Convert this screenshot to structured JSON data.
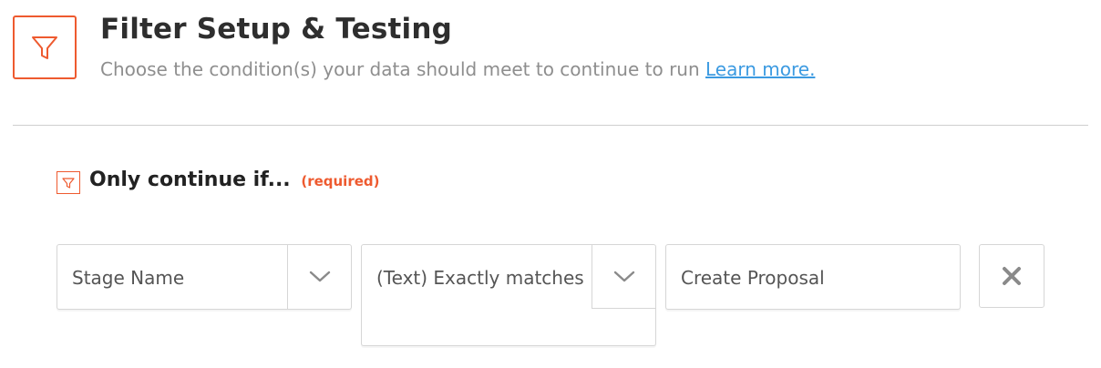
{
  "header": {
    "title": "Filter Setup & Testing",
    "subtitle": "Choose the condition(s) your data should meet to continue to run",
    "learn_more_label": "Learn more.",
    "icon": "filter-icon",
    "accent_color": "#ee5a2f",
    "link_color": "#3b9ae1"
  },
  "section": {
    "heading": "Only continue if...",
    "required_label": "(required)",
    "icon": "filter-icon"
  },
  "condition": {
    "field": {
      "value": "Stage Name",
      "icon": "chevron-down-icon"
    },
    "operator": {
      "value": "(Text) Exactly matches",
      "icon": "chevron-down-icon"
    },
    "value": {
      "value": "Create Proposal"
    },
    "remove": {
      "icon": "close-icon"
    }
  }
}
